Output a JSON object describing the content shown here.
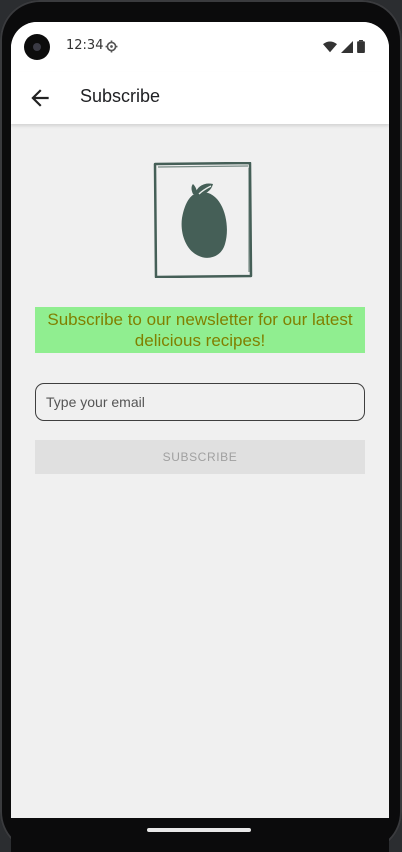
{
  "status_bar": {
    "time": "12:34",
    "icons": [
      "settings-icon",
      "wifi-icon",
      "signal-icon",
      "battery-icon"
    ]
  },
  "app_bar": {
    "back_icon": "arrow-left-icon",
    "title": "Subscribe"
  },
  "logo": {
    "icon": "lemon-icon",
    "color": "#455f57"
  },
  "promo": {
    "text": "Subscribe to our newsletter for our latest delicious recipes!",
    "background": "#90ee90",
    "text_color": "#808000"
  },
  "form": {
    "email_placeholder": "Type your email",
    "email_value": "",
    "subscribe_label": "SUBSCRIBE"
  }
}
